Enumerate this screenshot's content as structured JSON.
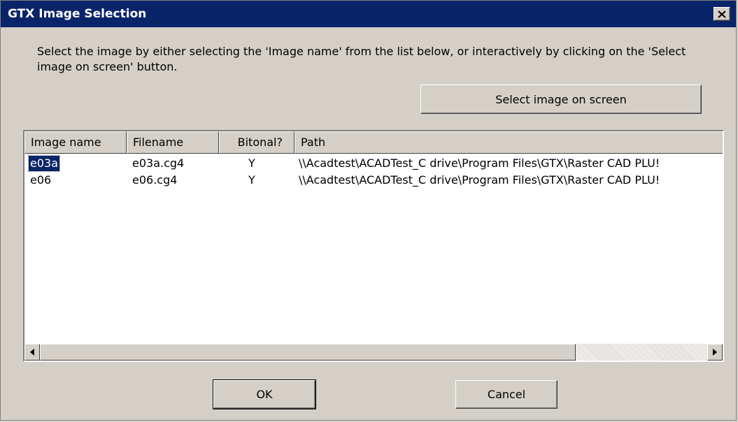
{
  "window": {
    "title": "GTX Image Selection",
    "close_icon": "close-icon"
  },
  "instructions": "Select the image by either selecting the 'Image name' from the list below, or interactively by clicking on the 'Select image on screen' button.",
  "select_button_label": "Select image on screen",
  "table": {
    "columns": [
      "Image name",
      "Filename",
      "Bitonal?",
      "Path"
    ],
    "rows": [
      {
        "name": "e03a",
        "filename": "e03a.cg4",
        "bitonal": "Y",
        "path": "\\\\Acadtest\\ACADTest_C drive\\Program Files\\GTX\\Raster CAD PLU!",
        "selected": true
      },
      {
        "name": "e06",
        "filename": "e06.cg4",
        "bitonal": "Y",
        "path": "\\\\Acadtest\\ACADTest_C drive\\Program Files\\GTX\\Raster CAD PLU!",
        "selected": false
      }
    ]
  },
  "buttons": {
    "ok": "OK",
    "cancel": "Cancel"
  },
  "colors": {
    "titlebar": "#0a246a",
    "face": "#d4d0c8",
    "selection": "#0a246a"
  }
}
